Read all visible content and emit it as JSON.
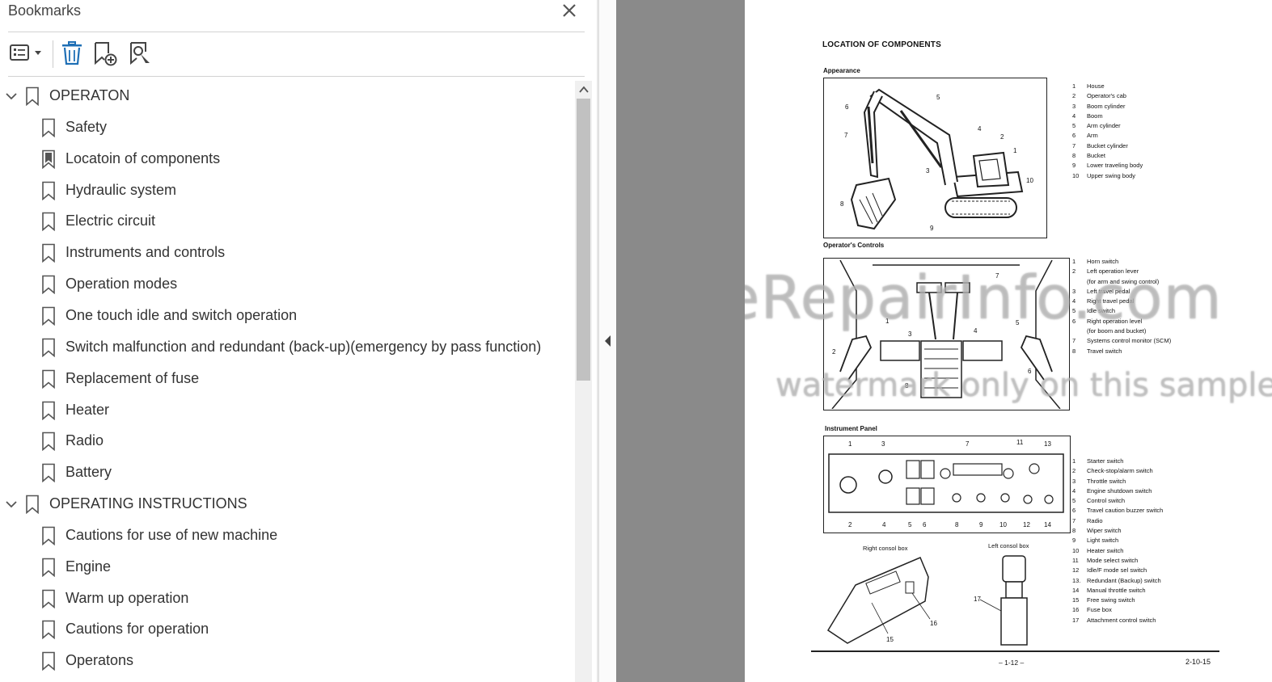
{
  "panel": {
    "title": "Bookmarks",
    "close_icon": "close-icon",
    "toolbar": {
      "options_icon": "list-options-icon",
      "delete_icon": "trash-icon",
      "new_icon": "add-bookmark-icon",
      "find_icon": "find-bookmark-icon"
    }
  },
  "bookmarks": [
    {
      "label": "OPERATON",
      "level": 0,
      "expanded": true
    },
    {
      "label": "Safety",
      "level": 1
    },
    {
      "label": "Locatoin of components",
      "level": 1,
      "current": true
    },
    {
      "label": "Hydraulic system",
      "level": 1
    },
    {
      "label": "Electric circuit",
      "level": 1
    },
    {
      "label": "Instruments and controls",
      "level": 1
    },
    {
      "label": "Operation modes",
      "level": 1
    },
    {
      "label": "One touch idle and switch operation",
      "level": 1
    },
    {
      "label": "Switch malfunction and redundant (back-up)(emergency by pass function)",
      "level": 1
    },
    {
      "label": "Replacement of fuse",
      "level": 1
    },
    {
      "label": "Heater",
      "level": 1
    },
    {
      "label": "Radio",
      "level": 1
    },
    {
      "label": "Battery",
      "level": 1
    },
    {
      "label": "OPERATING INSTRUCTIONS",
      "level": 0,
      "expanded": true
    },
    {
      "label": "Cautions for use of new machine",
      "level": 1
    },
    {
      "label": "Engine",
      "level": 1
    },
    {
      "label": "Warm up operation",
      "level": 1
    },
    {
      "label": "Cautions for operation",
      "level": 1
    },
    {
      "label": "Operatons",
      "level": 1
    }
  ],
  "page": {
    "heading": "LOCATION OF COMPONENTS",
    "appearance": {
      "title": "Appearance",
      "callouts": [
        "1",
        "2",
        "3",
        "4",
        "5",
        "6",
        "7",
        "8",
        "9",
        "10"
      ],
      "legend": [
        {
          "n": "1",
          "t": "House"
        },
        {
          "n": "2",
          "t": "Operator's cab"
        },
        {
          "n": "3",
          "t": "Boom cylinder"
        },
        {
          "n": "4",
          "t": "Boom"
        },
        {
          "n": "5",
          "t": "Arm cylinder"
        },
        {
          "n": "6",
          "t": "Arm"
        },
        {
          "n": "7",
          "t": "Bucket cylinder"
        },
        {
          "n": "8",
          "t": "Bucket"
        },
        {
          "n": "9",
          "t": "Lower traveling body"
        },
        {
          "n": "10",
          "t": "Upper swing body"
        }
      ]
    },
    "controls": {
      "title": "Operator's Controls",
      "callouts": [
        "1",
        "2",
        "3",
        "4",
        "5",
        "6",
        "7",
        "8"
      ],
      "legend": [
        {
          "n": "1",
          "t": "Horn switch"
        },
        {
          "n": "2",
          "t": "Left operation lever"
        },
        {
          "n": "",
          "t": "(for arm and swing control)"
        },
        {
          "n": "3",
          "t": "Left travel pedal"
        },
        {
          "n": "4",
          "t": "Right travel pedal"
        },
        {
          "n": "5",
          "t": "Idle switch"
        },
        {
          "n": "6",
          "t": "Right operation level"
        },
        {
          "n": "",
          "t": "(for boom and bucket)"
        },
        {
          "n": "7",
          "t": "Systems control monitor (SCM)"
        },
        {
          "n": "8",
          "t": "Travel switch"
        }
      ]
    },
    "panel": {
      "title": "Instrument Panel",
      "top_callouts": [
        "1",
        "3",
        "7",
        "11",
        "13"
      ],
      "bottom_callouts": [
        "2",
        "4",
        "5",
        "6",
        "8",
        "9",
        "10",
        "12",
        "14"
      ],
      "right_box": "Right consol box",
      "left_box": "Left consol box",
      "box_callouts": [
        "15",
        "16",
        "17"
      ],
      "legend": [
        {
          "n": "1",
          "t": "Starter switch"
        },
        {
          "n": "2",
          "t": "Check-stop/alarm switch"
        },
        {
          "n": "3",
          "t": "Throttle switch"
        },
        {
          "n": "4",
          "t": "Engine shutdown switch"
        },
        {
          "n": "5",
          "t": "Control switch"
        },
        {
          "n": "6",
          "t": "Travel caution buzzer switch"
        },
        {
          "n": "7",
          "t": "Radio"
        },
        {
          "n": "8",
          "t": "Wiper switch"
        },
        {
          "n": "9",
          "t": "Light switch"
        },
        {
          "n": "10",
          "t": "Heater switch"
        },
        {
          "n": "11",
          "t": "Mode select switch"
        },
        {
          "n": "12",
          "t": "Idle/F mode sel switch"
        },
        {
          "n": "13.",
          "t": "Redundant (Backup) switch"
        },
        {
          "n": "14",
          "t": "Manual throttle switch"
        },
        {
          "n": "15",
          "t": "Free swing switch"
        },
        {
          "n": "16",
          "t": "Fuse box"
        },
        {
          "n": "17",
          "t": "Attachment control switch"
        }
      ]
    },
    "watermark_1": "eRepairInfo.com",
    "watermark_2": "watermark only on this sample",
    "page_number": "– 1-12 –",
    "page_code": "2-10-15"
  }
}
